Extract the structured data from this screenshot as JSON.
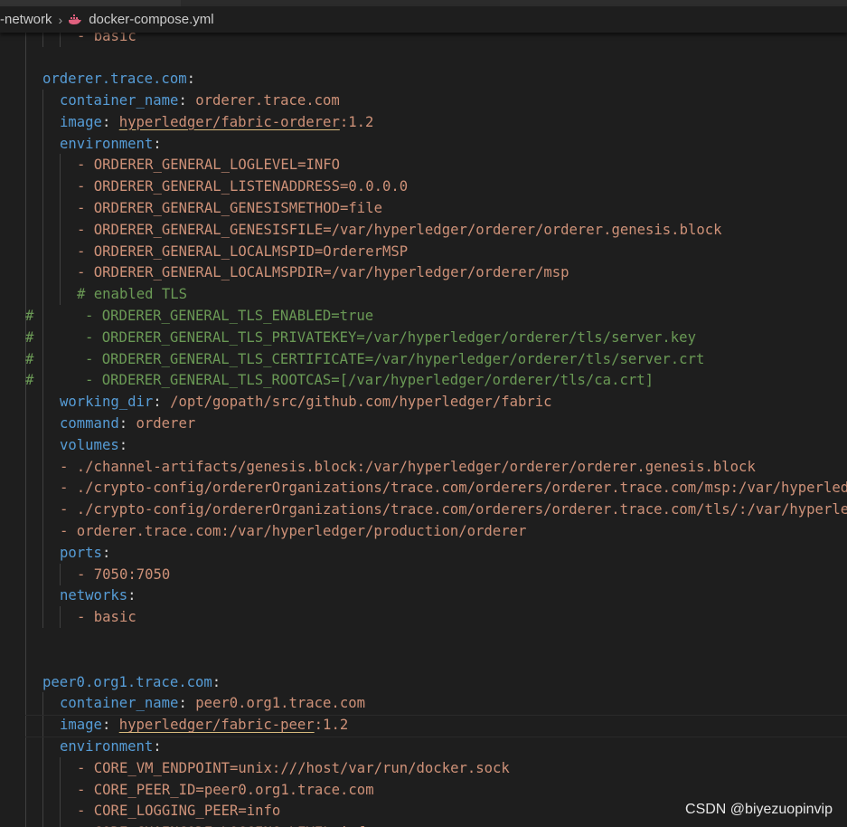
{
  "breadcrumb": {
    "folder": "-network",
    "separator": "›",
    "file_icon": "docker-whale-icon",
    "file": "docker-compose.yml"
  },
  "colors": {
    "background": "#1e1e1e",
    "key": "#569cd6",
    "string": "#ce9178",
    "comment": "#6a9955",
    "punctuation": "#d4d4d4",
    "indent_guide": "#404040"
  },
  "code": {
    "lines": [
      {
        "ln": 0,
        "h": "",
        "k": "",
        "p": "",
        "v": "- basic",
        "c": ""
      },
      {
        "ln": 1,
        "h": "",
        "k": "",
        "p": "",
        "v": "",
        "c": ""
      },
      {
        "ln": 2,
        "h": "",
        "k": "orderer.trace.com",
        "p": ":",
        "v": "",
        "c": ""
      },
      {
        "ln": 3,
        "h": "",
        "k": "container_name",
        "p": ": ",
        "v": "orderer.trace.com",
        "c": ""
      },
      {
        "ln": 4,
        "h": "",
        "k": "image",
        "p": ": ",
        "v": "hyperledger/fabric-orderer",
        "v2": ":1.2",
        "c": ""
      },
      {
        "ln": 5,
        "h": "",
        "k": "environment",
        "p": ":",
        "v": "",
        "c": ""
      },
      {
        "ln": 6,
        "h": "",
        "k": "",
        "p": "",
        "v": "- ORDERER_GENERAL_LOGLEVEL=INFO",
        "c": ""
      },
      {
        "ln": 7,
        "h": "",
        "k": "",
        "p": "",
        "v": "- ORDERER_GENERAL_LISTENADDRESS=0.0.0.0",
        "c": ""
      },
      {
        "ln": 8,
        "h": "",
        "k": "",
        "p": "",
        "v": "- ORDERER_GENERAL_GENESISMETHOD=file",
        "c": ""
      },
      {
        "ln": 9,
        "h": "",
        "k": "",
        "p": "",
        "v": "- ORDERER_GENERAL_GENESISFILE=/var/hyperledger/orderer/orderer.genesis.block",
        "c": ""
      },
      {
        "ln": 10,
        "h": "",
        "k": "",
        "p": "",
        "v": "- ORDERER_GENERAL_LOCALMSPID=OrdererMSP",
        "c": ""
      },
      {
        "ln": 11,
        "h": "",
        "k": "",
        "p": "",
        "v": "- ORDERER_GENERAL_LOCALMSPDIR=/var/hyperledger/orderer/msp",
        "c": ""
      },
      {
        "ln": 12,
        "h": "",
        "k": "",
        "p": "",
        "v": "",
        "c": "# enabled TLS"
      },
      {
        "ln": 13,
        "h": "#",
        "k": "",
        "p": "",
        "v": "",
        "c": "- ORDERER_GENERAL_TLS_ENABLED=true"
      },
      {
        "ln": 14,
        "h": "#",
        "k": "",
        "p": "",
        "v": "",
        "c": "- ORDERER_GENERAL_TLS_PRIVATEKEY=/var/hyperledger/orderer/tls/server.key"
      },
      {
        "ln": 15,
        "h": "#",
        "k": "",
        "p": "",
        "v": "",
        "c": "- ORDERER_GENERAL_TLS_CERTIFICATE=/var/hyperledger/orderer/tls/server.crt"
      },
      {
        "ln": 16,
        "h": "#",
        "k": "",
        "p": "",
        "v": "",
        "c": "- ORDERER_GENERAL_TLS_ROOTCAS=[/var/hyperledger/orderer/tls/ca.crt]"
      },
      {
        "ln": 17,
        "h": "",
        "k": "working_dir",
        "p": ": ",
        "v": "/opt/gopath/src/github.com/hyperledger/fabric",
        "c": ""
      },
      {
        "ln": 18,
        "h": "",
        "k": "command",
        "p": ": ",
        "v": "orderer",
        "c": ""
      },
      {
        "ln": 19,
        "h": "",
        "k": "volumes",
        "p": ":",
        "v": "",
        "c": ""
      },
      {
        "ln": 20,
        "h": "",
        "k": "",
        "p": "",
        "v": "- ./channel-artifacts/genesis.block:/var/hyperledger/orderer/orderer.genesis.block",
        "c": ""
      },
      {
        "ln": 21,
        "h": "",
        "k": "",
        "p": "",
        "v": "- ./crypto-config/ordererOrganizations/trace.com/orderers/orderer.trace.com/msp:/var/hyperledger/orderer/msp",
        "c": ""
      },
      {
        "ln": 22,
        "h": "",
        "k": "",
        "p": "",
        "v": "- ./crypto-config/ordererOrganizations/trace.com/orderers/orderer.trace.com/tls/:/var/hyperledger/orderer/tls",
        "c": ""
      },
      {
        "ln": 23,
        "h": "",
        "k": "",
        "p": "",
        "v": "- orderer.trace.com:/var/hyperledger/production/orderer",
        "c": ""
      },
      {
        "ln": 24,
        "h": "",
        "k": "ports",
        "p": ":",
        "v": "",
        "c": ""
      },
      {
        "ln": 25,
        "h": "",
        "k": "",
        "p": "",
        "v": "- 7050:7050",
        "c": ""
      },
      {
        "ln": 26,
        "h": "",
        "k": "networks",
        "p": ":",
        "v": "",
        "c": ""
      },
      {
        "ln": 27,
        "h": "",
        "k": "",
        "p": "",
        "v": "- basic",
        "c": ""
      },
      {
        "ln": 28,
        "h": "",
        "k": "",
        "p": "",
        "v": "",
        "c": ""
      },
      {
        "ln": 29,
        "h": "",
        "k": "",
        "p": "",
        "v": "",
        "c": ""
      },
      {
        "ln": 30,
        "h": "",
        "k": "peer0.org1.trace.com",
        "p": ":",
        "v": "",
        "c": ""
      },
      {
        "ln": 31,
        "h": "",
        "k": "container_name",
        "p": ": ",
        "v": "peer0.org1.trace.com",
        "c": ""
      },
      {
        "ln": 32,
        "h": "",
        "k": "image",
        "p": ": ",
        "v": "hyperledger/fabric-peer",
        "v2": ":1.2",
        "c": ""
      },
      {
        "ln": 33,
        "h": "",
        "k": "environment",
        "p": ":",
        "v": "",
        "c": ""
      },
      {
        "ln": 34,
        "h": "",
        "k": "",
        "p": "",
        "v": "- CORE_VM_ENDPOINT=unix:///host/var/run/docker.sock",
        "c": ""
      },
      {
        "ln": 35,
        "h": "",
        "k": "",
        "p": "",
        "v": "- CORE_PEER_ID=peer0.org1.trace.com",
        "c": ""
      },
      {
        "ln": 36,
        "h": "",
        "k": "",
        "p": "",
        "v": "- CORE_LOGGING_PEER=info",
        "c": ""
      },
      {
        "ln": 37,
        "h": "",
        "k": "",
        "p": "",
        "v": "- CORE_CHAINCODE_LOGGING_LEVEL=info",
        "c": ""
      }
    ]
  },
  "watermark": "CSDN @biyezuopinvip"
}
